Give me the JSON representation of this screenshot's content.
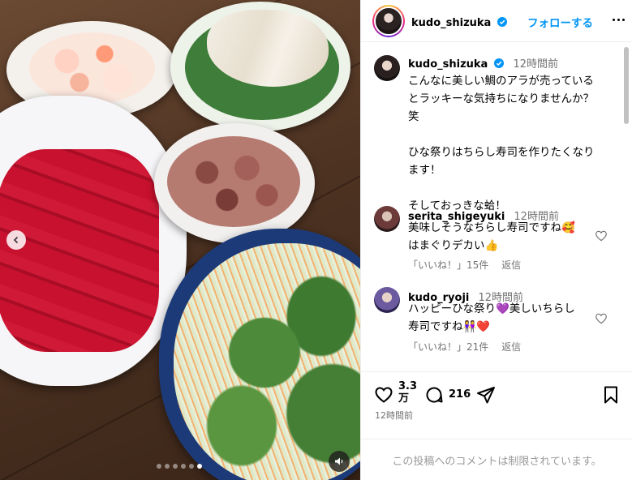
{
  "post": {
    "author": "kudo_shizuka",
    "follow_label": "フォローする",
    "caption_time": "12時間前",
    "caption_lines": [
      "こんなに美しい鯛のアラが売っている",
      "とラッキーな気持ちになりませんか？",
      "笑",
      "",
      "ひな祭りはちらし寿司を作りたくなり",
      "ます！",
      "",
      "そしておっきな蛤！"
    ],
    "likes_top": "3.3",
    "likes_unit": "万",
    "comments_count": "216",
    "posted_ago": "12時間前",
    "comments_disabled": "この投稿へのコメントは制限されています。"
  },
  "comments": [
    {
      "user": "serita_shigeyuki",
      "time": "12時間前",
      "line1": "美味しそうなちらし寿司ですね🥰",
      "line2": "はまぐりデカい👍",
      "likes": "「いいね！」15件",
      "reply": "返信"
    },
    {
      "user": "kudo_ryoji",
      "time": "12時間前",
      "line1": "ハッピーひな祭り💜美しいちらし",
      "line2": "寿司ですね👭❤️",
      "likes": "「いいね！」21件",
      "reply": "返信"
    }
  ],
  "carousel": {
    "total": 6,
    "active": 5
  },
  "colors": {
    "accent": "#0095f6",
    "muted": "#737373"
  },
  "icons": [
    "verified-badge-icon",
    "more-options-icon",
    "heart-icon",
    "comment-icon",
    "share-icon",
    "bookmark-icon",
    "chevron-left-icon",
    "audio-icon"
  ]
}
